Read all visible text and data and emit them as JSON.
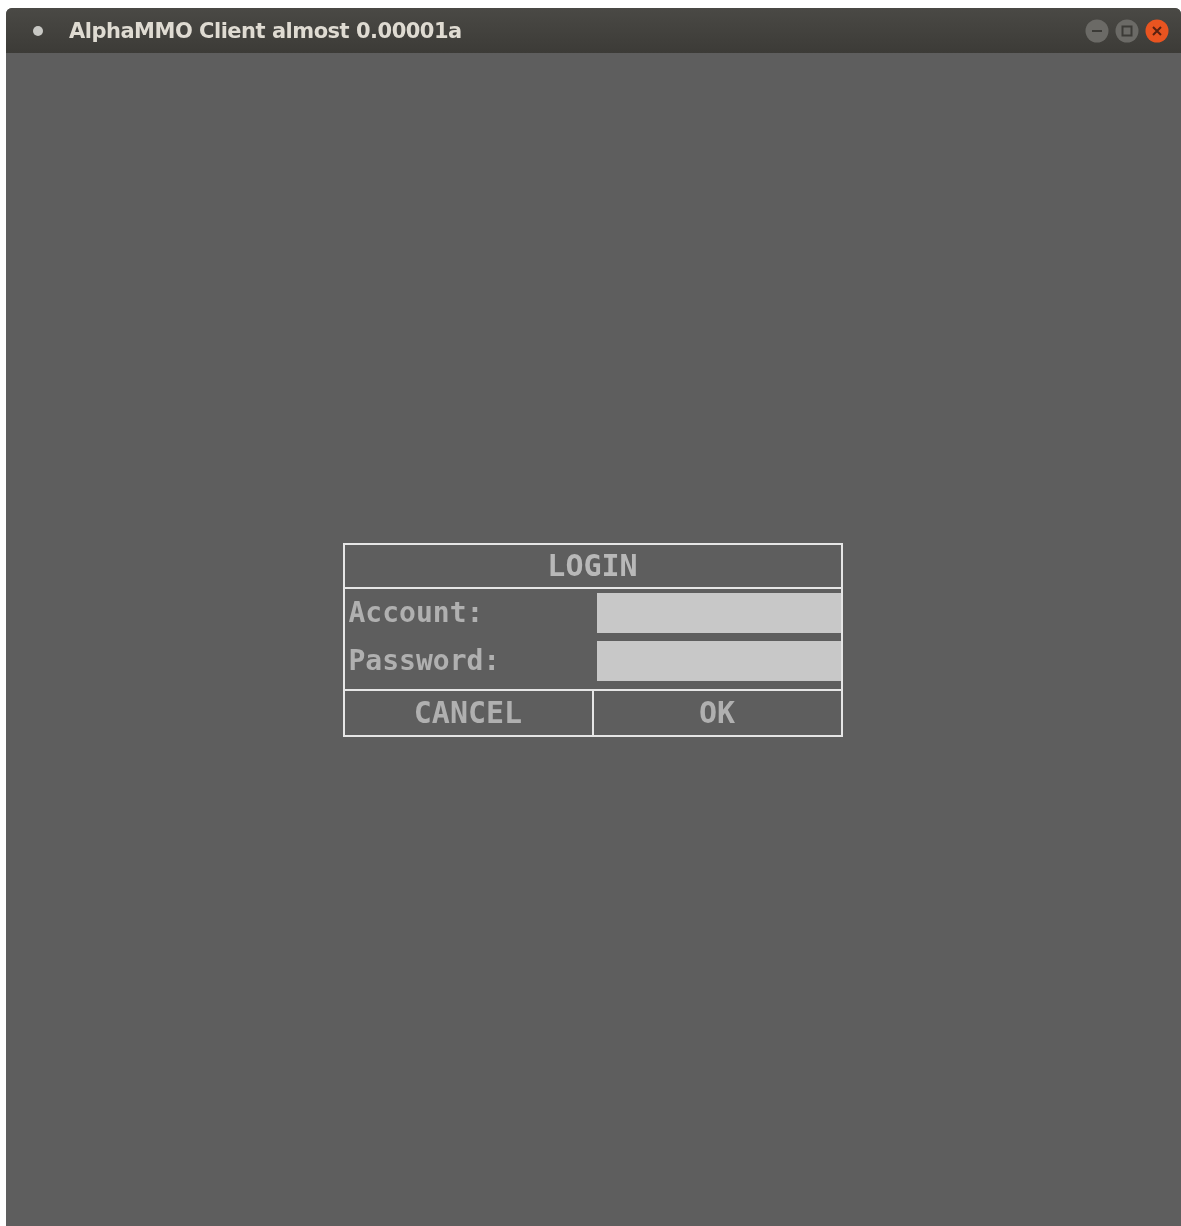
{
  "window": {
    "title": "AlphaMMO Client almost 0.00001a"
  },
  "dialog": {
    "title": "LOGIN",
    "fields": [
      {
        "label": "Account:"
      },
      {
        "label": "Password:"
      }
    ],
    "buttons": [
      "CANCEL",
      "OK"
    ]
  }
}
